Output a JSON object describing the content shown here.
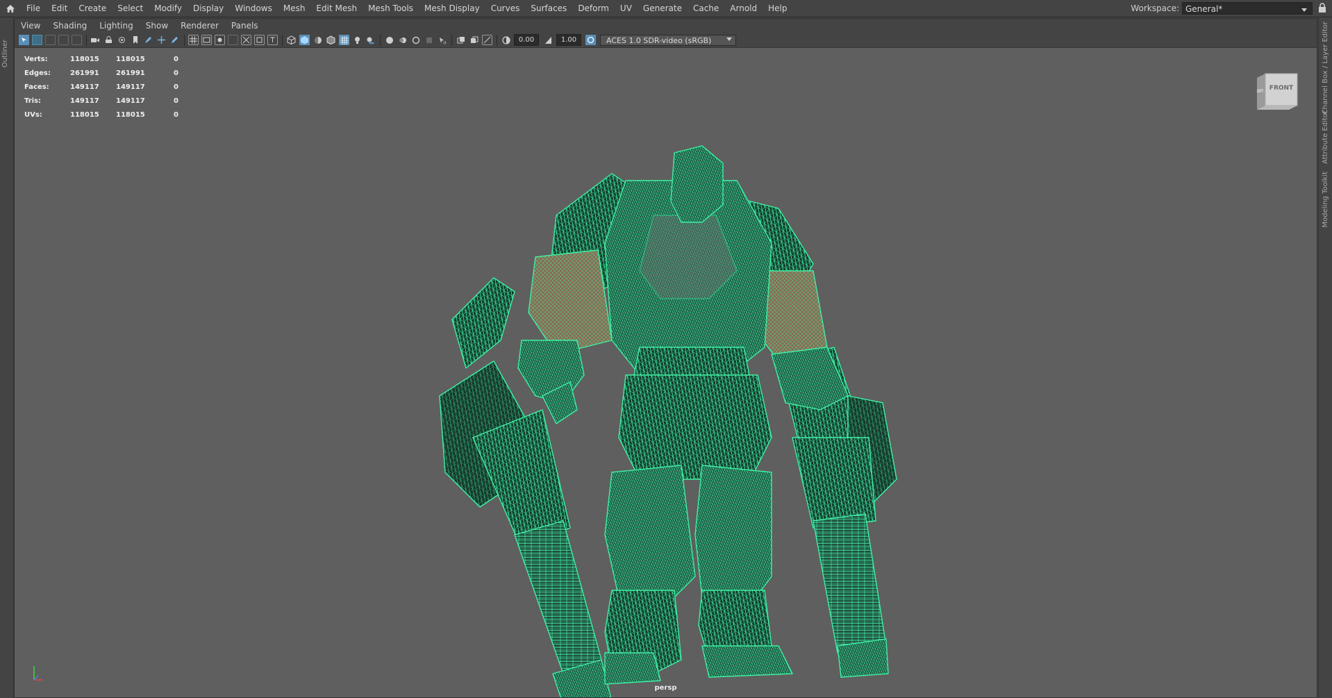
{
  "menubar": {
    "items": [
      "File",
      "Edit",
      "Create",
      "Select",
      "Modify",
      "Display",
      "Windows",
      "Mesh",
      "Edit Mesh",
      "Mesh Tools",
      "Mesh Display",
      "Curves",
      "Surfaces",
      "Deform",
      "UV",
      "Generate",
      "Cache",
      "Arnold",
      "Help"
    ],
    "workspace_label": "Workspace:",
    "workspace_value": "General*",
    "home_icon": "home-icon",
    "lock_icon": "lock-icon"
  },
  "side_tabs": {
    "left": "Outliner",
    "right": [
      "Channel Box / Layer Editor",
      "Attribute Editor",
      "Modeling Toolkit"
    ]
  },
  "panel": {
    "menu": [
      "View",
      "Shading",
      "Lighting",
      "Show",
      "Renderer",
      "Panels"
    ],
    "exposure": "0.00",
    "gamma": "1.00",
    "color_space": "ACES 1.0 SDR-video (sRGB)"
  },
  "hud": {
    "rows": [
      {
        "label": "Verts:",
        "a": "118015",
        "b": "118015",
        "c": "0"
      },
      {
        "label": "Edges:",
        "a": "261991",
        "b": "261991",
        "c": "0"
      },
      {
        "label": "Faces:",
        "a": "149117",
        "b": "149117",
        "c": "0"
      },
      {
        "label": "Tris:",
        "a": "149117",
        "b": "149117",
        "c": "0"
      },
      {
        "label": "UVs:",
        "a": "118015",
        "b": "118015",
        "c": "0"
      }
    ]
  },
  "viewport": {
    "camera": "persp",
    "viewcube_front": "FRONT",
    "viewcube_left": "LEFT",
    "wire_color": "#3ff0a4",
    "background": "#5f5f5f"
  }
}
